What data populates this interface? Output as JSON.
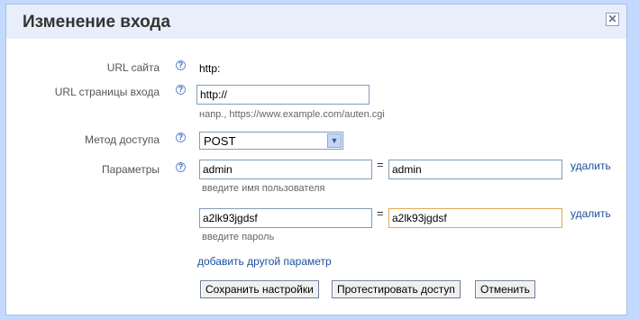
{
  "dialog": {
    "title": "Изменение входа",
    "close_glyph": "✕"
  },
  "site_url": {
    "label": "URL сайта",
    "value": "http:"
  },
  "login_page_url": {
    "label": "URL страницы входа",
    "value": "http://",
    "hint": "напр., https://www.example.com/auten.cgi"
  },
  "access_method": {
    "label": "Метод доступа",
    "selected": "POST"
  },
  "parameters": {
    "label": "Параметры",
    "rows": [
      {
        "name": "admin",
        "value": "admin",
        "hint": "введите имя пользователя",
        "remove_label": "удалить"
      },
      {
        "name": "a2lk93jgdsf",
        "value": "a2lk93jgdsf",
        "hint": "введите пароль",
        "remove_label": "удалить"
      }
    ],
    "equals": "=",
    "add_label": "добавить другой параметр"
  },
  "buttons": {
    "save": "Сохранить настройки",
    "test": "Протестировать доступ",
    "cancel": "Отменить"
  },
  "help_glyph": "?",
  "colors": {
    "background": "#c3d9ff",
    "titlebar": "#e8eefa",
    "link": "#1a4f9c",
    "focus_border": "#e8a84c"
  }
}
